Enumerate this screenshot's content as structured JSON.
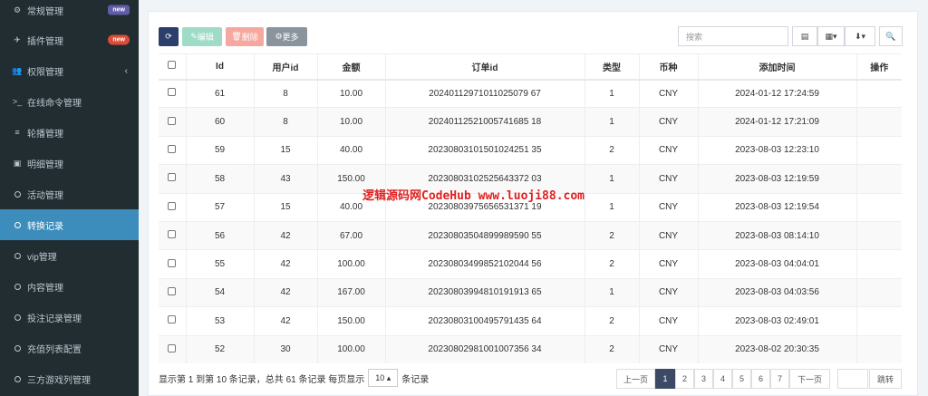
{
  "sidebar": {
    "items": [
      {
        "label": "常规管理",
        "icon": "cogs-icon",
        "badge": "new"
      },
      {
        "label": "插件管理",
        "icon": "rocket-icon",
        "badge": "new"
      },
      {
        "label": "权限管理",
        "icon": "group-icon",
        "chevron": "‹"
      },
      {
        "label": "在线命令管理",
        "icon": "terminal-icon"
      },
      {
        "label": "轮播管理",
        "icon": "bars-icon"
      },
      {
        "label": "明细管理",
        "icon": "calendar-icon"
      },
      {
        "label": "活动管理",
        "icon": "circle-icon"
      },
      {
        "label": "转换记录",
        "icon": "circle-icon",
        "active": true
      },
      {
        "label": "vip管理",
        "icon": "circle-icon"
      },
      {
        "label": "内容管理",
        "icon": "circle-icon"
      },
      {
        "label": "投注记录管理",
        "icon": "circle-icon"
      },
      {
        "label": "充值列表配置",
        "icon": "circle-icon"
      },
      {
        "label": "三方游戏列管理",
        "icon": "circle-icon"
      }
    ]
  },
  "toolbar": {
    "edit_label": "编辑",
    "delete_label": "删除",
    "more_label": "更多"
  },
  "search": {
    "placeholder": "搜索"
  },
  "table": {
    "headers": [
      "Id",
      "用户id",
      "金额",
      "订单id",
      "类型",
      "币种",
      "添加时间",
      "操作"
    ],
    "rows": [
      [
        "61",
        "8",
        "10.00",
        "20240112971011025079 67",
        "1",
        "CNY",
        "2024-01-12 17:24:59"
      ],
      [
        "60",
        "8",
        "10.00",
        "20240112521005741685 18",
        "1",
        "CNY",
        "2024-01-12 17:21:09"
      ],
      [
        "59",
        "15",
        "40.00",
        "20230803101501024251 35",
        "2",
        "CNY",
        "2023-08-03 12:23:10"
      ],
      [
        "58",
        "43",
        "150.00",
        "20230803102525643372 03",
        "1",
        "CNY",
        "2023-08-03 12:19:59"
      ],
      [
        "57",
        "15",
        "40.00",
        "20230803975656531371 19",
        "1",
        "CNY",
        "2023-08-03 12:19:54"
      ],
      [
        "56",
        "42",
        "67.00",
        "20230803504899989590 55",
        "2",
        "CNY",
        "2023-08-03 08:14:10"
      ],
      [
        "55",
        "42",
        "100.00",
        "20230803499852102044 56",
        "2",
        "CNY",
        "2023-08-03 04:04:01"
      ],
      [
        "54",
        "42",
        "167.00",
        "20230803994810191913 65",
        "1",
        "CNY",
        "2023-08-03 04:03:56"
      ],
      [
        "53",
        "42",
        "150.00",
        "20230803100495791435 64",
        "2",
        "CNY",
        "2023-08-03 02:49:01"
      ],
      [
        "52",
        "30",
        "100.00",
        "20230802981001007356 34",
        "2",
        "CNY",
        "2023-08-02 20:30:35"
      ]
    ]
  },
  "footer": {
    "summary": "显示第 1 到第 10 条记录，总共 61 条记录 每页显示",
    "page_size": "10",
    "suffix": "条记录",
    "prev": "上一页",
    "pages": [
      "1",
      "2",
      "3",
      "4",
      "5",
      "6",
      "7"
    ],
    "next": "下一页",
    "jump": "跳转"
  },
  "watermark": "逻辑源码网CodeHub www.luoji88.com",
  "colors": {
    "sidebar_bg": "#222d32",
    "active": "#3c8dbc",
    "refresh_btn": "#2c3e6b",
    "edit_btn": "#9fdcc8",
    "delete_btn": "#f6a8a0",
    "more_btn": "#8a949c"
  }
}
